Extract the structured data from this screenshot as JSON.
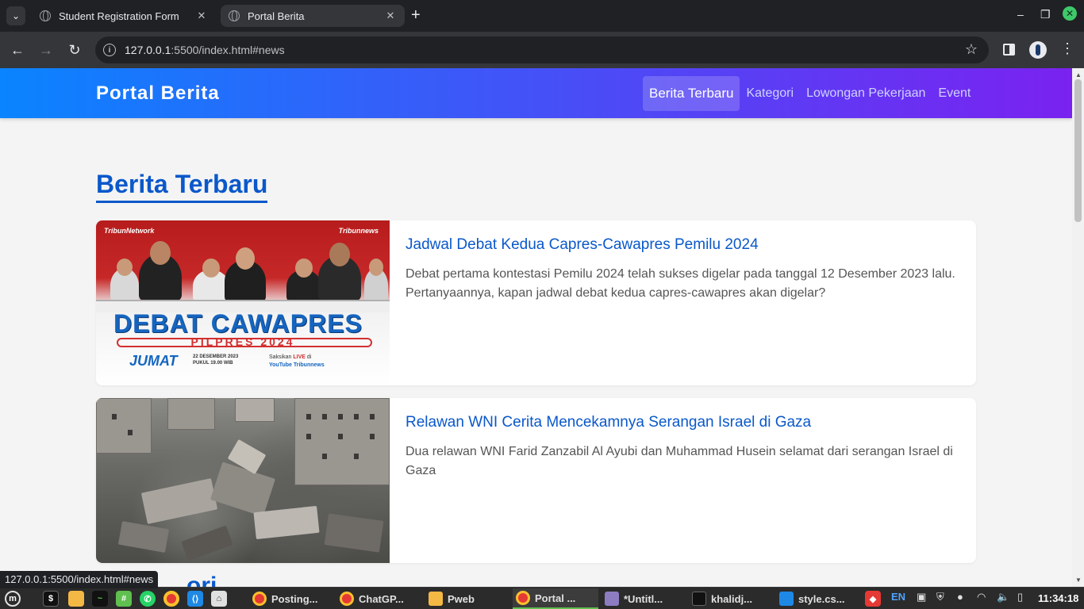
{
  "browser": {
    "tabs": [
      {
        "title": "Student Registration Form",
        "active": false
      },
      {
        "title": "Portal Berita",
        "active": true
      }
    ],
    "url_host": "127.0.0.1",
    "url_rest": ":5500/index.html#news",
    "status_url": "127.0.0.1:5500/index.html#news"
  },
  "site": {
    "logo": "Portal Berita",
    "nav": [
      {
        "label": "Berita Terbaru",
        "active": true
      },
      {
        "label": "Kategori",
        "active": false
      },
      {
        "label": "Lowongan Pekerjaan",
        "active": false
      },
      {
        "label": "Event",
        "active": false
      }
    ],
    "section_title": "Berita Terbaru",
    "next_section_partial": "...ori"
  },
  "news": [
    {
      "title": "Jadwal Debat Kedua Capres-Cawapres Pemilu 2024",
      "text": "Debat pertama kontestasi Pemilu 2024 telah sukses digelar pada tanggal 12 Desember 2023 lalu. Pertanyaannya, kapan jadwal debat kedua capres-cawapres akan digelar?"
    },
    {
      "title": "Relawan WNI Cerita Mencekamnya Serangan Israel di Gaza",
      "text": "Dua relawan WNI Farid Zanzabil Al Ayubi dan Muhammad Husein selamat dari serangan Israel di Gaza"
    }
  ],
  "poster": {
    "logo_left": "TribunNetwork",
    "logo_right": "Tribunnews",
    "headline": "DEBAT CAWAPRES",
    "sub": "PILPRES 2024",
    "day": "JUMAT",
    "date_line1": "22 DESEMBER 2023",
    "date_line2": "PUKUL 19.00 WIB",
    "watch": "Saksikan",
    "live": "LIVE",
    "at": "di",
    "channel": "YouTube Tribunnews"
  },
  "taskbar": {
    "apps": [
      {
        "label": "Posting...",
        "color": "#e53935"
      },
      {
        "label": "ChatGP...",
        "color": "#e53935"
      },
      {
        "label": "Pweb",
        "color": "#f4b844"
      },
      {
        "label": "Portal ...",
        "color": "#e53935"
      },
      {
        "label": "*Untitl...",
        "color": "#8e7cc3"
      },
      {
        "label": "khalidj...",
        "color": "#333333"
      },
      {
        "label": "style.cs...",
        "color": "#1e88e5"
      }
    ],
    "lang": "EN",
    "clock": "11:34:18"
  },
  "colors": {
    "accent": "#0a58ca",
    "header_gradient_start": "#0a84ff",
    "header_gradient_end": "#7a22f0",
    "page_bg": "#f4f4f4"
  }
}
